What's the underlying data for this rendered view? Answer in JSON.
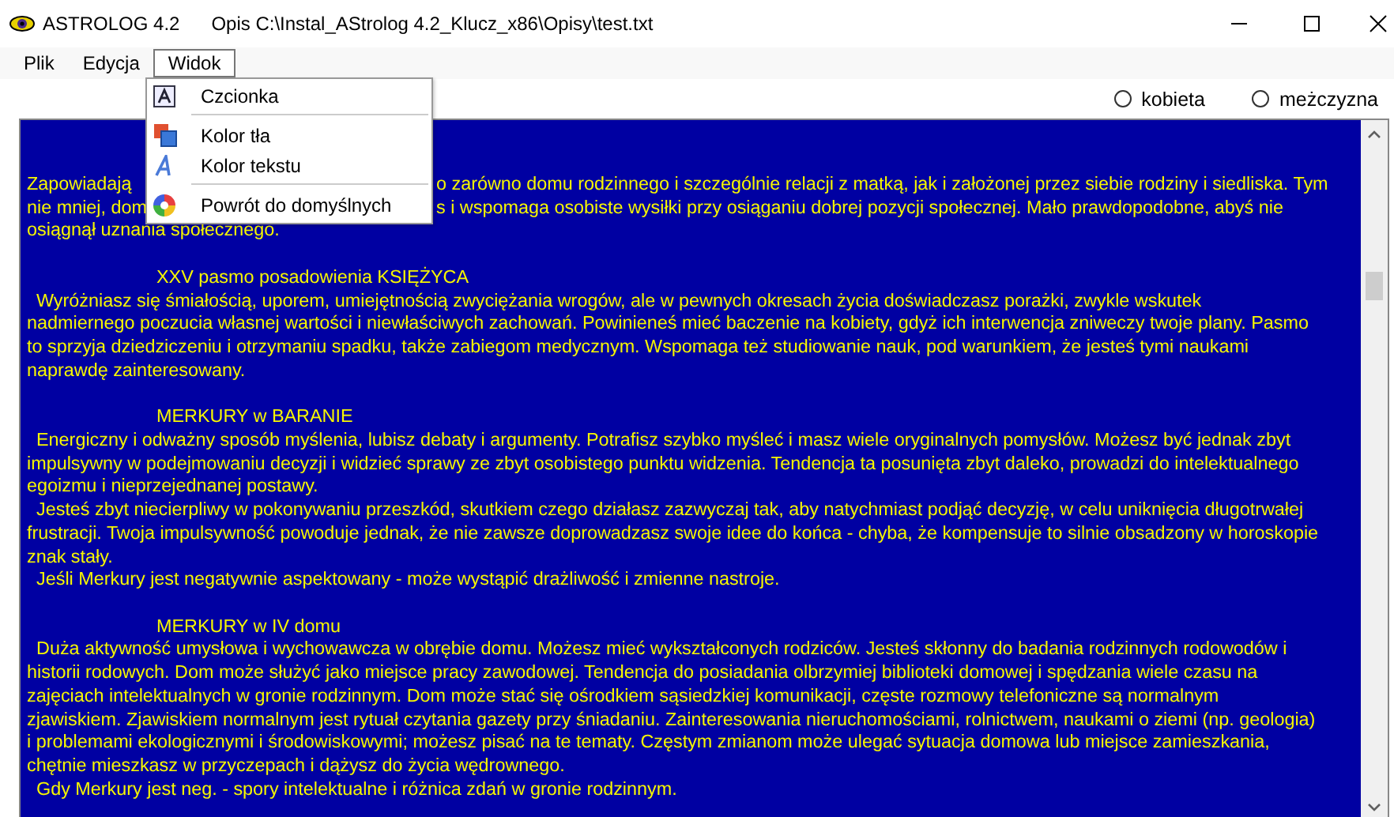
{
  "window": {
    "app_name": "ASTROLOG 4.2",
    "title": "Opis  C:\\Instal_AStrolog 4.2_Klucz_x86\\Opisy\\test.txt"
  },
  "menu_bar": [
    {
      "label": "Plik",
      "selected": false
    },
    {
      "label": "Edycja",
      "selected": false
    },
    {
      "label": "Widok",
      "selected": true
    }
  ],
  "dropdown": [
    {
      "kind": "item",
      "label": "Czcionka"
    },
    {
      "kind": "separator"
    },
    {
      "kind": "item",
      "label": "Kolor tła"
    },
    {
      "kind": "item",
      "label": "Kolor tekstu"
    },
    {
      "kind": "separator"
    },
    {
      "kind": "item",
      "label": "Powrót do domyślnych"
    }
  ],
  "gender": [
    {
      "label": "kobieta",
      "selected": false
    },
    {
      "label": "meżczyzna",
      "selected": false
    }
  ],
  "lines": [
    {
      "kind": "split",
      "left": "Zapowiadają",
      "right": "o zarówno domu rodzinnego i szczególnie relacji z matką, jak i założonej przez siebie rodziny i siedliska. Tym"
    },
    {
      "kind": "split",
      "left": "nie mniej, dom",
      "right": "s i wspomaga osobiste wysiłki przy osiąganiu dobrej pozycji społecznej. Mało prawdopodobne, abyś nie"
    },
    {
      "kind": "cont",
      "text": "osiągnął uznania społecznego."
    },
    {
      "kind": "blank"
    },
    {
      "kind": "heading",
      "text": "XXV pasmo posadowienia KSIĘŻYCA"
    },
    {
      "kind": "first",
      "text": "Wyróżniasz się śmiałością, uporem, umiejętnością zwyciężania wrogów, ale w pewnych okresach życia doświadczasz porażki, zwykle wskutek"
    },
    {
      "kind": "cont",
      "text": "nadmiernego poczucia własnej wartości i niewłaściwych zachowań. Powinieneś mieć baczenie na kobiety, gdyż ich interwencja zniweczy twoje plany. Pasmo"
    },
    {
      "kind": "cont",
      "text": "to sprzyja dziedziczeniu i otrzymaniu spadku, także zabiegom medycznym. Wspomaga też studiowanie nauk, pod warunkiem, że jesteś tymi naukami"
    },
    {
      "kind": "cont",
      "text": "naprawdę zainteresowany."
    },
    {
      "kind": "blank"
    },
    {
      "kind": "heading",
      "text": "MERKURY w BARANIE"
    },
    {
      "kind": "first",
      "text": "Energiczny i odważny sposób myślenia, lubisz debaty i argumenty. Potrafisz szybko myśleć i masz wiele oryginalnych pomysłów. Możesz być jednak zbyt"
    },
    {
      "kind": "cont",
      "text": "impulsywny w podejmowaniu decyzji i widzieć sprawy ze zbyt osobistego punktu widzenia. Tendencja ta posunięta zbyt daleko, prowadzi do intelektualnego"
    },
    {
      "kind": "cont",
      "text": "egoizmu i nieprzejednanej postawy."
    },
    {
      "kind": "first",
      "text": "Jesteś zbyt niecierpliwy w pokonywaniu przeszkód, skutkiem czego działasz zazwyczaj tak, aby natychmiast podjąć decyzję, w celu uniknięcia długotrwałej"
    },
    {
      "kind": "cont",
      "text": "frustracji. Twoja impulsywność powoduje jednak, że nie zawsze doprowadzasz swoje idee do końca - chyba, że kompensuje to silnie obsadzony w horoskopie"
    },
    {
      "kind": "cont",
      "text": "znak stały."
    },
    {
      "kind": "first",
      "text": "Jeśli Merkury jest negatywnie aspektowany - może wystąpić drażliwość i zmienne nastroje."
    },
    {
      "kind": "blank"
    },
    {
      "kind": "heading",
      "text": "MERKURY w IV domu"
    },
    {
      "kind": "first",
      "text": "Duża aktywność umysłowa i wychowawcza w obrębie domu. Możesz mieć wykształconych rodziców. Jesteś skłonny do badania rodzinnych rodowodów i"
    },
    {
      "kind": "cont",
      "text": "historii rodowych. Dom może służyć jako miejsce pracy zawodowej. Tendencja do posiadania olbrzymiej biblioteki domowej i spędzania wiele czasu na"
    },
    {
      "kind": "cont",
      "text": "zajęciach intelektualnych w gronie rodzinnym. Dom może stać się ośrodkiem sąsiedzkiej komunikacji, częste rozmowy telefoniczne są normalnym"
    },
    {
      "kind": "cont",
      "text": "zjawiskiem. Zjawiskiem normalnym jest rytuał czytania gazety przy śniadaniu. Zainteresowania nieruchomościami, rolnictwem, naukami o ziemi (np. geologia)"
    },
    {
      "kind": "cont",
      "text": "i problemami ekologicznymi i środowiskowymi; możesz pisać na te tematy. Częstym zmianom może ulegać sytuacja domowa lub miejsce zamieszkania,"
    },
    {
      "kind": "cont",
      "text": "chętnie mieszkasz w przyczepach i dążysz do życia wędrownego."
    },
    {
      "kind": "first",
      "text": "Gdy Merkury jest neg. - spory intelektualne i różnica zdań w gronie rodzinnym."
    }
  ]
}
